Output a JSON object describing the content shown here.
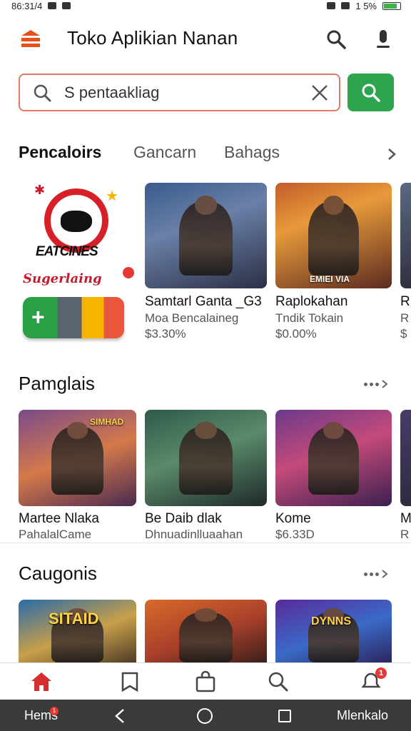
{
  "status_bar": {
    "time": "86:31/4",
    "battery": "1 5%"
  },
  "app_bar": {
    "title": "Toko Aplikian Nanan",
    "icons": [
      "menu-icon",
      "search-icon",
      "mic-icon"
    ]
  },
  "search": {
    "placeholder": "S pentaakliag",
    "value": ""
  },
  "tabs": {
    "items": [
      "Pencaloirs",
      "Gancarn",
      "Bahags"
    ],
    "active": "Pencaloirs"
  },
  "featured": {
    "banner_title": "EATCINES",
    "banner_subtitle": "Sugerlaing",
    "cards": [
      {
        "title": "Samtarl Ganta _G3",
        "subtitle": "Moa Bencalaineg",
        "price": "$3.30%",
        "image_caption": ""
      },
      {
        "title": "Raplokahan",
        "subtitle": "Tndik Tokain",
        "price": "$0.00%",
        "image_caption": "EMIEI VIA"
      },
      {
        "title": "R",
        "subtitle": "R",
        "price": "$",
        "image_caption": ""
      }
    ]
  },
  "section_popular": {
    "title": "Pamglais",
    "cards": [
      {
        "title": "Martee Nlaka",
        "subtitle": "PahalalCame",
        "image_caption": "SIMHAD"
      },
      {
        "title": "Be Daib dlak",
        "subtitle": "Dhnuadinlluaahan",
        "image_caption": ""
      },
      {
        "title": "Kome",
        "subtitle": "$6.33D",
        "image_caption": ""
      },
      {
        "title": "M",
        "subtitle": "R",
        "image_caption": ""
      }
    ]
  },
  "section_categories": {
    "title": "Caugonis",
    "cards": [
      {
        "image_caption": "SITAID"
      },
      {
        "image_caption": ""
      },
      {
        "image_caption": "DYNNS"
      }
    ]
  },
  "bottom_nav": {
    "items": [
      "home-icon",
      "bookmark-icon",
      "shopping-bag-icon",
      "search-icon",
      "notifications-icon"
    ],
    "active": "home-icon",
    "badge": "1"
  },
  "system_nav": {
    "left_label": "Hems",
    "left_badge": "1",
    "right_label": "Mlenkalo"
  },
  "colors": {
    "accent": "#e8501c",
    "search_button": "#2da44e",
    "search_border": "#e07a66",
    "active_nav": "#d32f2f"
  }
}
